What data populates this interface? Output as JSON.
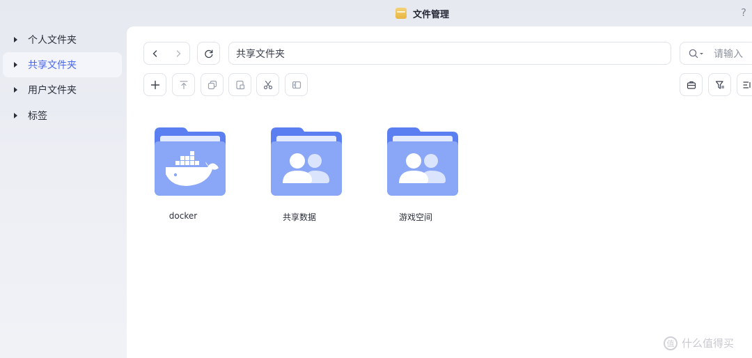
{
  "window": {
    "title": "文件管理",
    "help": "?"
  },
  "sidebar": {
    "items": [
      {
        "label": "个人文件夹",
        "active": false
      },
      {
        "label": "共享文件夹",
        "active": true
      },
      {
        "label": "用户文件夹",
        "active": false
      },
      {
        "label": "标签",
        "active": false
      }
    ]
  },
  "toolbar": {
    "path": "共享文件夹",
    "search_placeholder": "请输入"
  },
  "folders": [
    {
      "name": "docker",
      "icon": "docker-whale-icon"
    },
    {
      "name": "共享数据",
      "icon": "users-icon"
    },
    {
      "name": "游戏空间",
      "icon": "users-icon"
    }
  ],
  "colors": {
    "accent": "#4a67e8",
    "folder_back": "#5b7ff0",
    "folder_front": "#8aa6f6"
  },
  "watermark": {
    "text": "什么值得买",
    "icon_glyph": "值"
  }
}
